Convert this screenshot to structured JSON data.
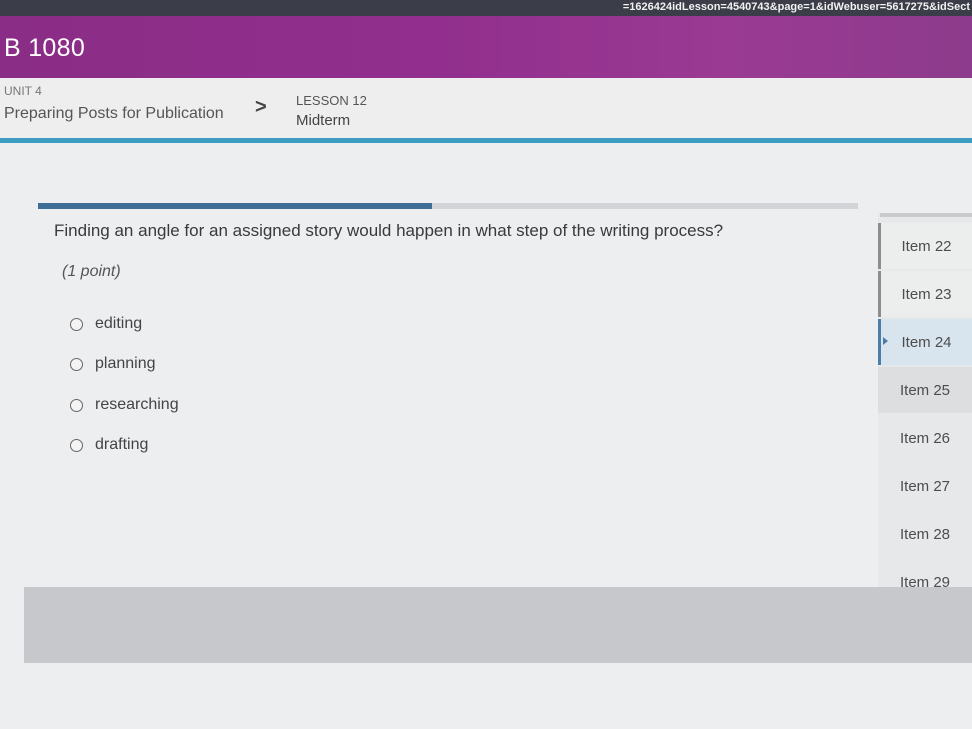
{
  "browser": {
    "url_fragment": "=1626424idLesson=4540743&page=1&idWebuser=5617275&idSect"
  },
  "course": {
    "title": "B 1080"
  },
  "breadcrumb": {
    "unit_label": "UNIT 4",
    "unit_title": "Preparing Posts for Publication",
    "separator": ">",
    "lesson_label": "LESSON 12",
    "lesson_title": "Midterm"
  },
  "quiz": {
    "progress_fraction": 0.48,
    "question": "Finding an angle for an assigned story would happen in what step of the writing process?",
    "points": "(1 point)",
    "options": [
      "editing",
      "planning",
      "researching",
      "drafting"
    ]
  },
  "item_nav": {
    "items": [
      "Item 22",
      "Item 23",
      "Item 24",
      "Item 25",
      "Item 26",
      "Item 27",
      "Item 28",
      "Item 29"
    ],
    "active_index": 2
  },
  "colors": {
    "banner_purple": "#922f8e",
    "accent_blue": "#3c9cc2",
    "progress_blue": "#3e6e95"
  }
}
